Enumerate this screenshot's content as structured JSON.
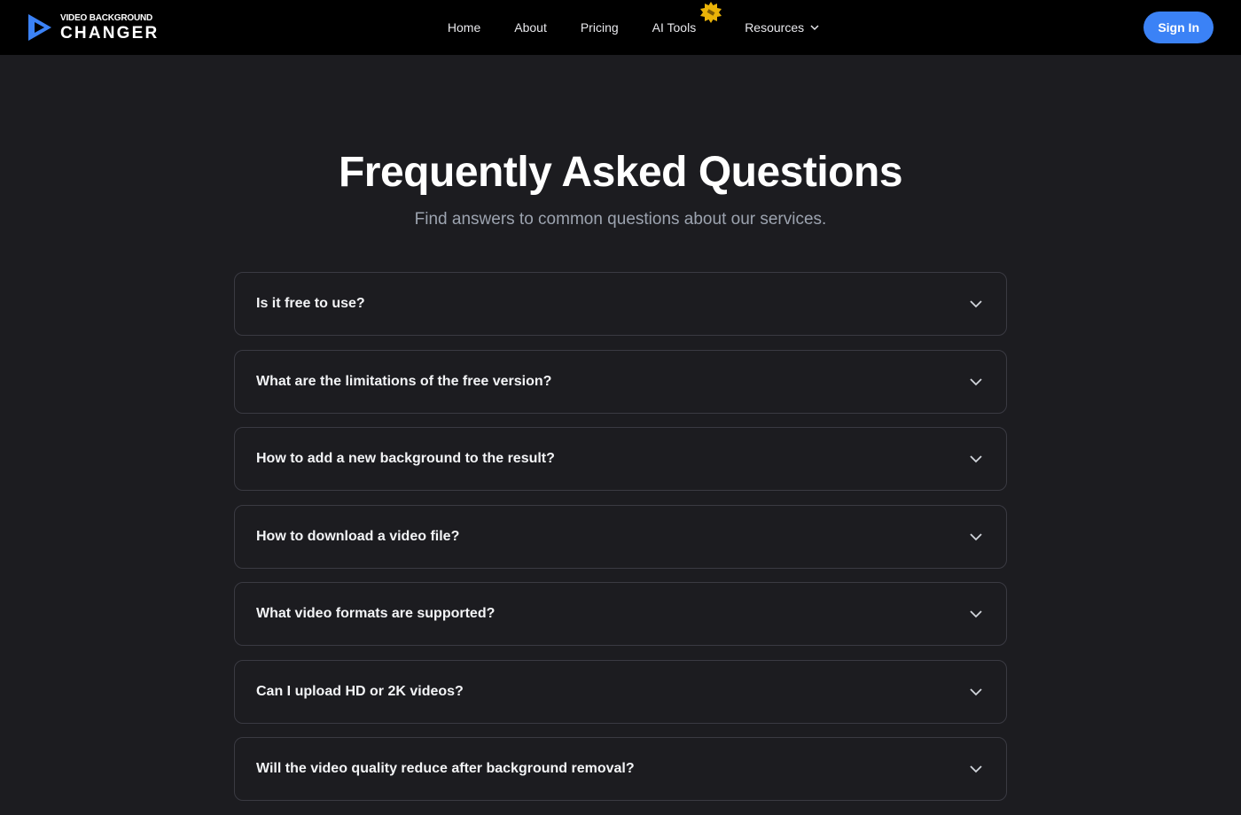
{
  "brand": {
    "line1": "VIDEO BACKGROUND",
    "line2": "CHANGER",
    "accent": "#3b82f6"
  },
  "nav": {
    "items": [
      {
        "label": "Home"
      },
      {
        "label": "About"
      },
      {
        "label": "Pricing"
      },
      {
        "label": "AI Tools",
        "badge": "new-badge-icon"
      },
      {
        "label": "Resources",
        "icon": "chevron-down-icon"
      }
    ],
    "signin_label": "Sign In"
  },
  "hero": {
    "title": "Frequently Asked Questions",
    "subtitle": "Find answers to common questions about our services."
  },
  "faq": [
    {
      "question": "Is it free to use?"
    },
    {
      "question": "What are the limitations of the free version?"
    },
    {
      "question": "How to add a new background to the result?"
    },
    {
      "question": "How to download a video file?"
    },
    {
      "question": "What video formats are supported?"
    },
    {
      "question": "Can I upload HD or 2K videos?"
    },
    {
      "question": "Will the video quality reduce after background removal?"
    }
  ],
  "colors": {
    "page_bg": "#1c1c20",
    "nav_bg": "#000000",
    "button": "#3b82f6",
    "badge": "#eab308"
  }
}
